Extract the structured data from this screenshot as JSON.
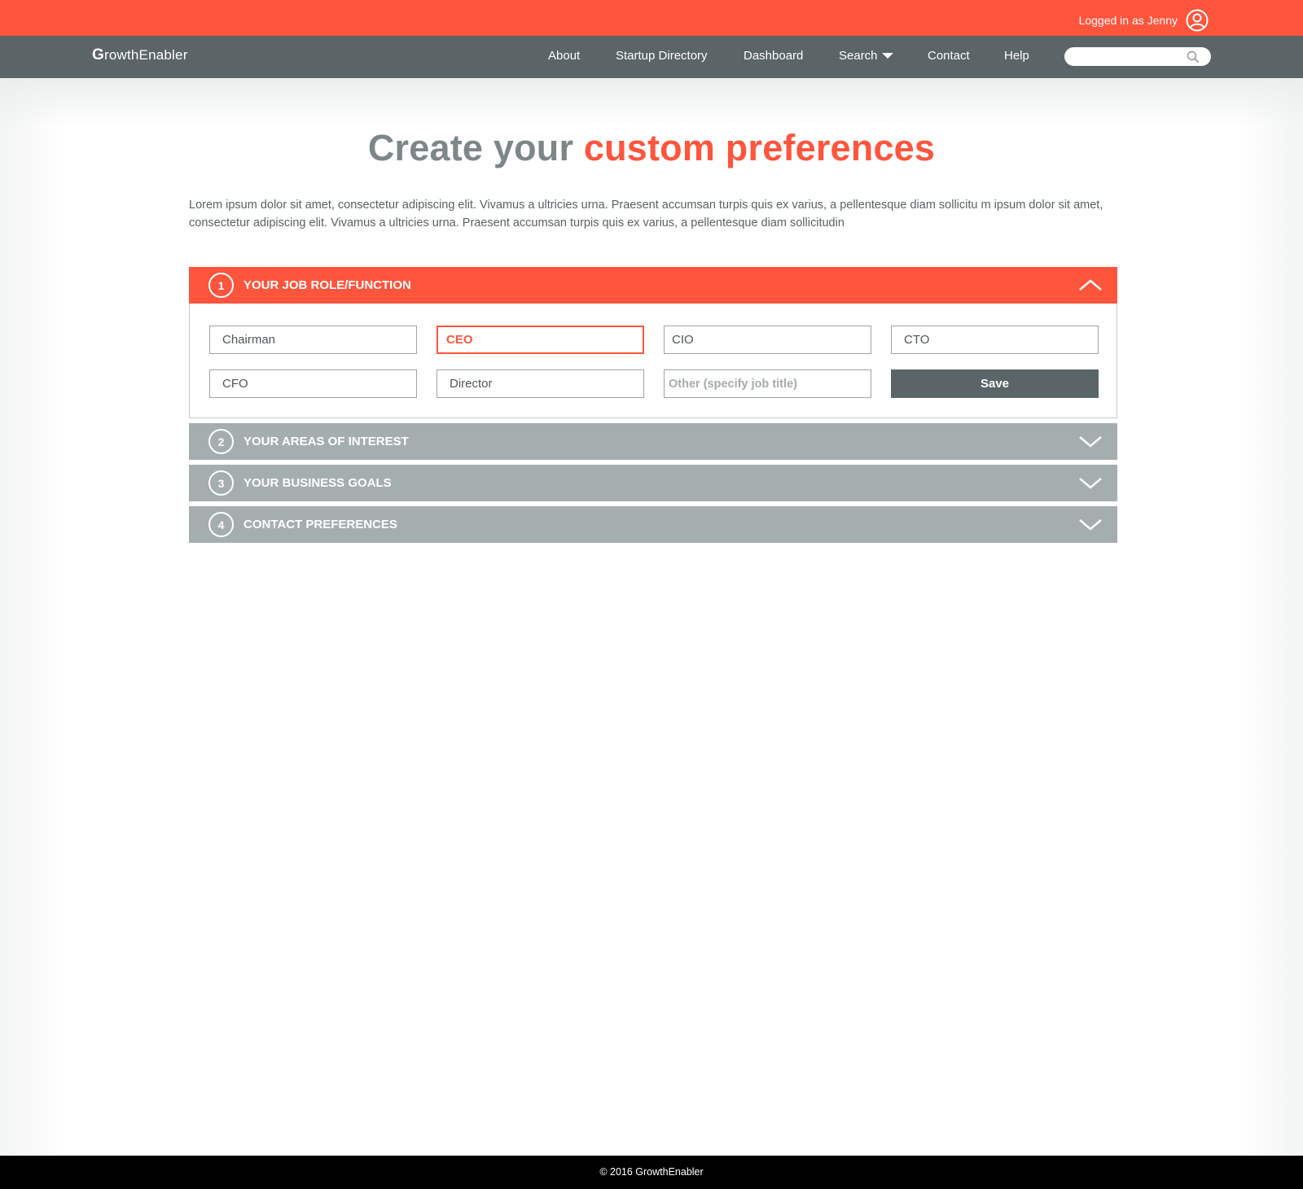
{
  "topbar": {
    "login_text": "Logged in as Jenny",
    "user_icon": "user-circle-icon"
  },
  "nav": {
    "logo_initial": "G",
    "logo_rest": "rowthEnabler",
    "links": [
      "About",
      "Startup Directory",
      "Dashboard",
      "Search",
      "Contact",
      "Help"
    ],
    "search_placeholder": "",
    "search_icon": "magnifier-icon"
  },
  "main": {
    "title_plain": "Create your ",
    "title_accent": "custom preferences",
    "intro": "Lorem ipsum dolor sit amet, consectetur adipiscing elit. Vivamus a ultricies urna. Praesent accumsan turpis quis ex varius, a pellentesque diam sollicitu m ipsum dolor sit amet, consectetur adipiscing elit. Vivamus a ultricies urna. Praesent accumsan turpis quis ex varius, a pellentesque diam sollicitudin"
  },
  "accordion": {
    "sections": [
      {
        "number": "1",
        "title": "YOUR JOB ROLE/FUNCTION",
        "state": "open"
      },
      {
        "number": "2",
        "title": "YOUR AREAS OF INTEREST",
        "state": "closed"
      },
      {
        "number": "3",
        "title": "YOUR BUSINESS GOALS",
        "state": "closed"
      },
      {
        "number": "4",
        "title": "CONTACT PREFERENCES",
        "state": "closed"
      }
    ],
    "job_options": [
      "Chairman",
      "CEO",
      "CIO",
      "CTO",
      "CFO",
      "Director"
    ],
    "selected_option": "CEO",
    "other_placeholder": "Other (specify job title)",
    "save_label": "Save"
  },
  "footer": {
    "copyright": "© 2016 GrowthEnabler"
  },
  "colors": {
    "accent": "#ff553d",
    "nav_bg": "#5b6466",
    "collapsed_header": "#a5aeae",
    "footer_bg": "#000000"
  }
}
